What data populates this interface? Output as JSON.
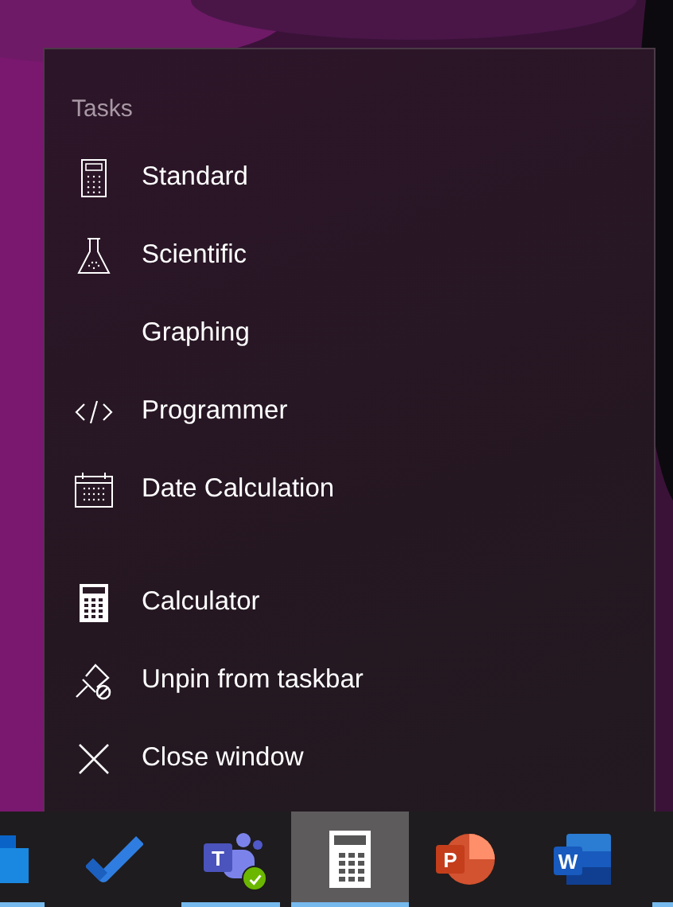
{
  "jump_list": {
    "sections": [
      {
        "heading": "Tasks",
        "items": [
          {
            "label": "Standard",
            "kind": "standard"
          },
          {
            "label": "Scientific",
            "kind": "scientific"
          },
          {
            "label": "Graphing",
            "kind": "graphing"
          },
          {
            "label": "Programmer",
            "kind": "programmer"
          },
          {
            "label": "Date Calculation",
            "kind": "date"
          }
        ]
      },
      {
        "items": [
          {
            "label": "Calculator",
            "kind": "app"
          },
          {
            "label": "Unpin from taskbar",
            "kind": "unpin"
          },
          {
            "label": "Close window",
            "kind": "close"
          }
        ]
      }
    ]
  },
  "taskbar": {
    "items": [
      {
        "kind": "mail",
        "running": true,
        "selected": false
      },
      {
        "kind": "todo",
        "running": false,
        "selected": false
      },
      {
        "kind": "teams",
        "letter": "T",
        "running": true,
        "selected": false
      },
      {
        "kind": "calculator",
        "running": true,
        "selected": true
      },
      {
        "kind": "slides",
        "letter": "P",
        "running": false,
        "selected": false
      },
      {
        "kind": "doc",
        "letter": "W",
        "running": false,
        "selected": false
      },
      {
        "kind": "offscreen",
        "running": true,
        "selected": false
      }
    ]
  }
}
